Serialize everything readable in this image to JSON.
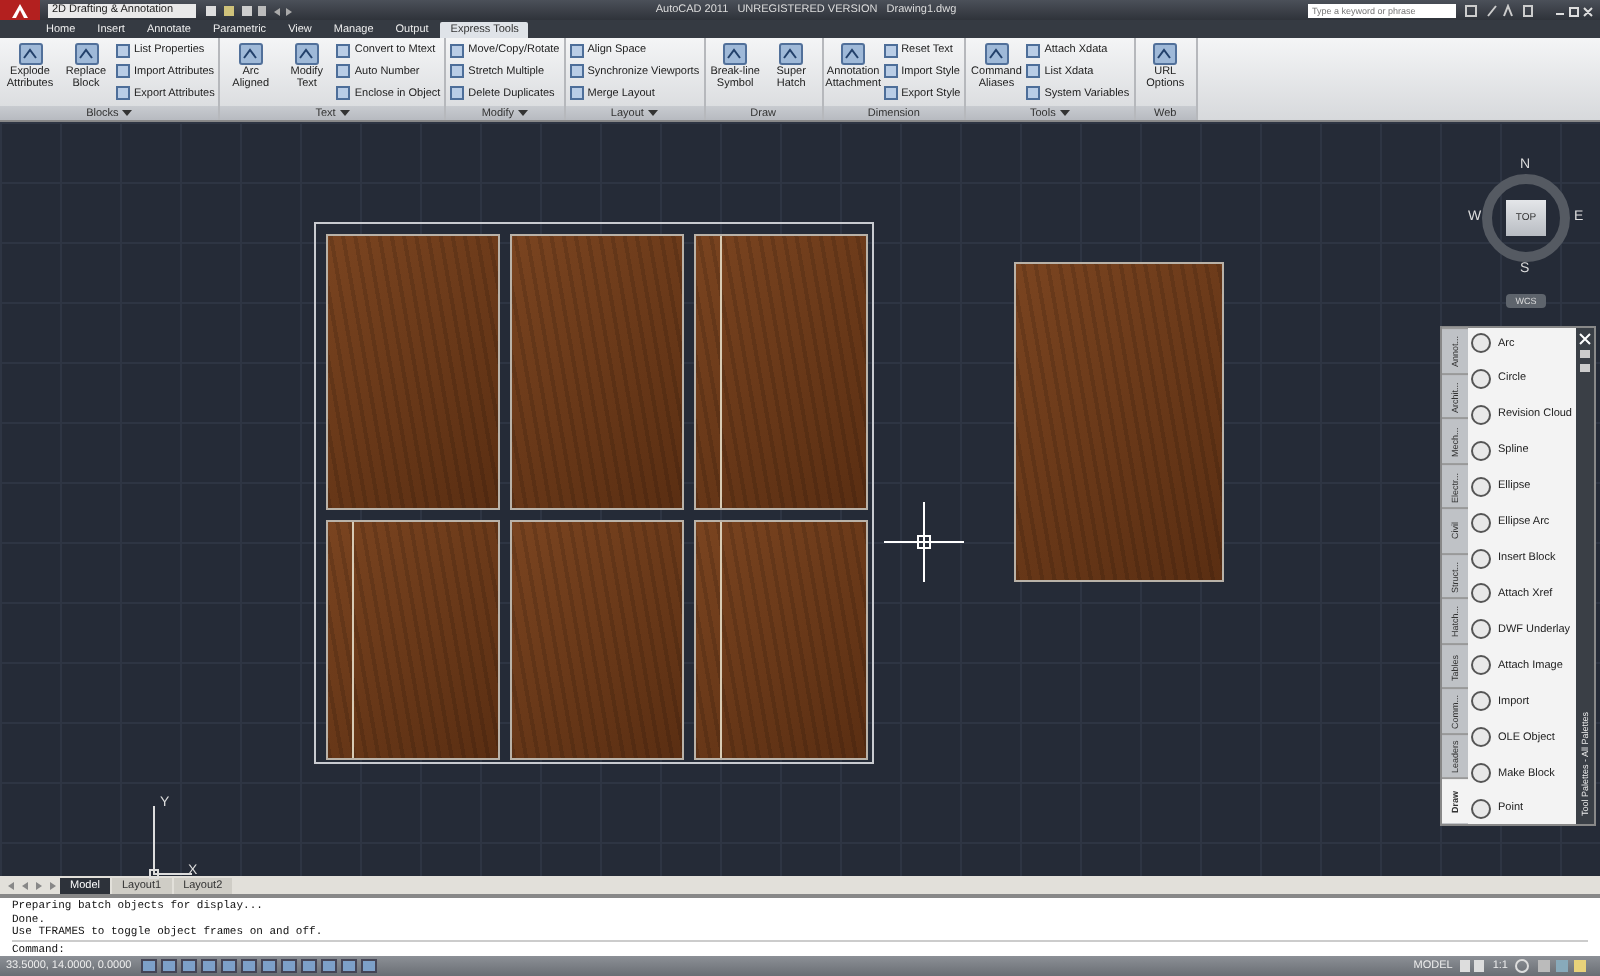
{
  "window": {
    "workspace": "2D Drafting & Annotation",
    "title": "AutoCAD 2011   UNREGISTERED VERSION   Drawing1.dwg",
    "search": {
      "placeholder": "Type a keyword or phrase"
    }
  },
  "ribbon": {
    "tabs": [
      {
        "label": "Home",
        "selected": false
      },
      {
        "label": "Insert",
        "selected": false
      },
      {
        "label": "Annotate",
        "selected": false
      },
      {
        "label": "Parametric",
        "selected": false
      },
      {
        "label": "View",
        "selected": false
      },
      {
        "label": "Manage",
        "selected": false
      },
      {
        "label": "Output",
        "selected": false
      },
      {
        "label": "Express Tools",
        "selected": true
      }
    ],
    "panels": [
      {
        "title": "Blocks",
        "expandable": true,
        "large": [
          "Explode Attributes",
          "Replace Block"
        ],
        "small": [
          "List Properties",
          "Import Attributes",
          "Export Attributes"
        ]
      },
      {
        "title": "Text",
        "expandable": true,
        "large": [
          "Arc Aligned",
          "Modify Text"
        ],
        "small": [
          "Convert to Mtext",
          "Auto Number",
          "Enclose in Object"
        ]
      },
      {
        "title": "Modify",
        "expandable": true,
        "small": [
          "Move/Copy/Rotate",
          "Stretch Multiple",
          "Delete Duplicates"
        ]
      },
      {
        "title": "Layout",
        "expandable": true,
        "small": [
          "Align Space",
          "Synchronize Viewports",
          "Merge Layout"
        ]
      },
      {
        "title": "Draw",
        "expandable": false,
        "large": [
          "Break-line Symbol",
          "Super Hatch"
        ]
      },
      {
        "title": "Dimension",
        "expandable": false,
        "large": [
          "Annotation Attachment"
        ],
        "small": [
          "Reset Text",
          "Import Style",
          "Export Style"
        ]
      },
      {
        "title": "Tools",
        "expandable": true,
        "large": [
          "Command Aliases"
        ],
        "small": [
          "Attach Xdata",
          "List Xdata",
          "System Variables"
        ]
      },
      {
        "title": "Web",
        "expandable": false,
        "large": [
          "URL Options"
        ]
      }
    ]
  },
  "viewcube": {
    "north": "N",
    "west": "W",
    "east": "E",
    "south": "S",
    "face": "TOP",
    "ucs": "WCS"
  },
  "ucs_icon": {
    "x": "X",
    "y": "Y"
  },
  "tool_palette": {
    "title": "Tool Palettes - All Palettes",
    "tabs": [
      {
        "label": "Annot...",
        "selected": false
      },
      {
        "label": "Archit...",
        "selected": false
      },
      {
        "label": "Mech...",
        "selected": false
      },
      {
        "label": "Electr...",
        "selected": false
      },
      {
        "label": "Civil",
        "selected": false
      },
      {
        "label": "Struct...",
        "selected": false
      },
      {
        "label": "Hatch...",
        "selected": false
      },
      {
        "label": "Tables",
        "selected": false
      },
      {
        "label": "Comm...",
        "selected": false
      },
      {
        "label": "Leaders",
        "selected": false
      },
      {
        "label": "Draw",
        "selected": true
      }
    ],
    "items": [
      "Arc",
      "Circle",
      "Revision Cloud",
      "Spline",
      "Ellipse",
      "Ellipse Arc",
      "Insert Block",
      "Attach Xref",
      "DWF Underlay",
      "Attach Image",
      "Import",
      "OLE Object",
      "Make Block",
      "Point"
    ]
  },
  "layout_tabs": [
    {
      "label": "Model",
      "selected": true
    },
    {
      "label": "Layout1",
      "selected": false
    },
    {
      "label": "Layout2",
      "selected": false
    }
  ],
  "command": {
    "history": [
      "Preparing batch objects for display...",
      "Done.",
      "Use TFRAMES to toggle object frames on and off."
    ],
    "prompt": "Command:"
  },
  "status_bar": {
    "coordinates": "33.5000, 14.0000, 0.0000",
    "space": "MODEL",
    "scale": "1:1"
  }
}
